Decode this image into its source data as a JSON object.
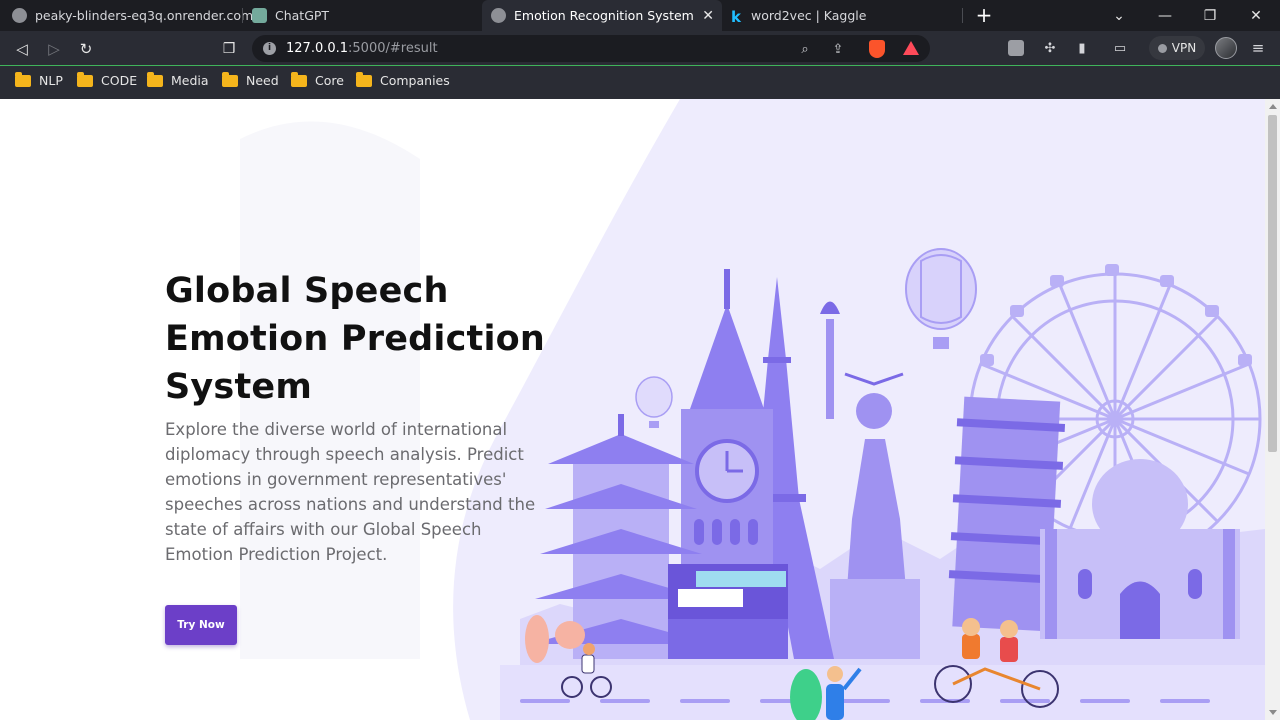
{
  "browser": {
    "tabs": [
      {
        "title": "peaky-blinders-eq3q.onrender.com",
        "favicon": "globe-icon",
        "active": false
      },
      {
        "title": "ChatGPT",
        "favicon": "chatgpt-icon",
        "active": false
      },
      {
        "title": "Emotion Recognition System",
        "favicon": "globe-icon",
        "active": true
      },
      {
        "title": "word2vec | Kaggle",
        "favicon": "kaggle-icon",
        "active": false
      }
    ],
    "address_host": "127.0.0.1",
    "address_rest": ":5000/#result",
    "vpn_label": "VPN",
    "bookmarks": [
      "NLP",
      "CODE",
      "Media",
      "Need",
      "Core",
      "Companies"
    ]
  },
  "page": {
    "title_lines": [
      "Global Speech",
      "Emotion Prediction",
      "System"
    ],
    "description": "Explore the diverse world of international diplomacy through speech analysis. Predict emotions in government representatives' speeches across nations and understand the state of affairs with our Global Speech Emotion Prediction Project.",
    "cta_label": "Try Now"
  },
  "colors": {
    "accent": "#6c3fc8",
    "illustration_light": "#eceafd",
    "illustration_mid": "#b2a8f5",
    "illustration_dark": "#7b6ae6",
    "chrome_bg": "#2a2c34",
    "tabstrip_bg": "#1c1d22",
    "folder": "#f5b51c"
  }
}
